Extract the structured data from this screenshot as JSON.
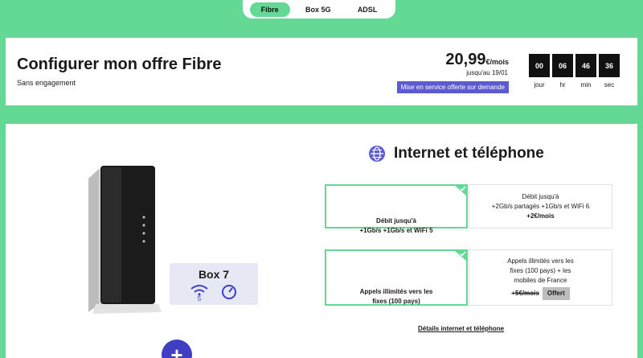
{
  "tabs": [
    {
      "label": "Fibre",
      "active": true
    },
    {
      "label": "Box 5G",
      "active": false
    },
    {
      "label": "ADSL",
      "active": false
    }
  ],
  "header": {
    "title": "Configurer mon offre Fibre",
    "subtitle": "Sans engagement",
    "price": "20,99",
    "price_unit": "€/mois",
    "price_until": "jusqu'au 19/01",
    "promo": "Mise en service offerte sur demande"
  },
  "countdown": [
    {
      "value": "00",
      "label": "jour"
    },
    {
      "value": "06",
      "label": "hr"
    },
    {
      "value": "46",
      "label": "min"
    },
    {
      "value": "36",
      "label": "sec"
    }
  ],
  "product": {
    "name": "Box 7",
    "wifi_level": "5"
  },
  "section": {
    "title": "Internet et téléphone",
    "debit_selected": "Débit jusqu'à\n+1Gb/s +1Gb/s et WiFi 5",
    "debit_alt_l1": "Débit jusqu'à",
    "debit_alt_l2": "+2Gb/s partagés +1Gb/s et WiFi 6",
    "debit_alt_price": "+2€/mois",
    "appels_selected": "Appels illimités vers les\nfixes (100 pays)",
    "appels_alt_l1": "Appels illimités vers les",
    "appels_alt_l2": "fixes (100 pays) + les",
    "appels_alt_l3": "mobiles de France",
    "appels_alt_old_price": "+5€/mois",
    "appels_alt_badge": "Offert",
    "details_link": "Détails internet et téléphone"
  },
  "colors": {
    "background": "#63d995",
    "accent": "#5d5bd4",
    "button": "#3f3fc4"
  }
}
